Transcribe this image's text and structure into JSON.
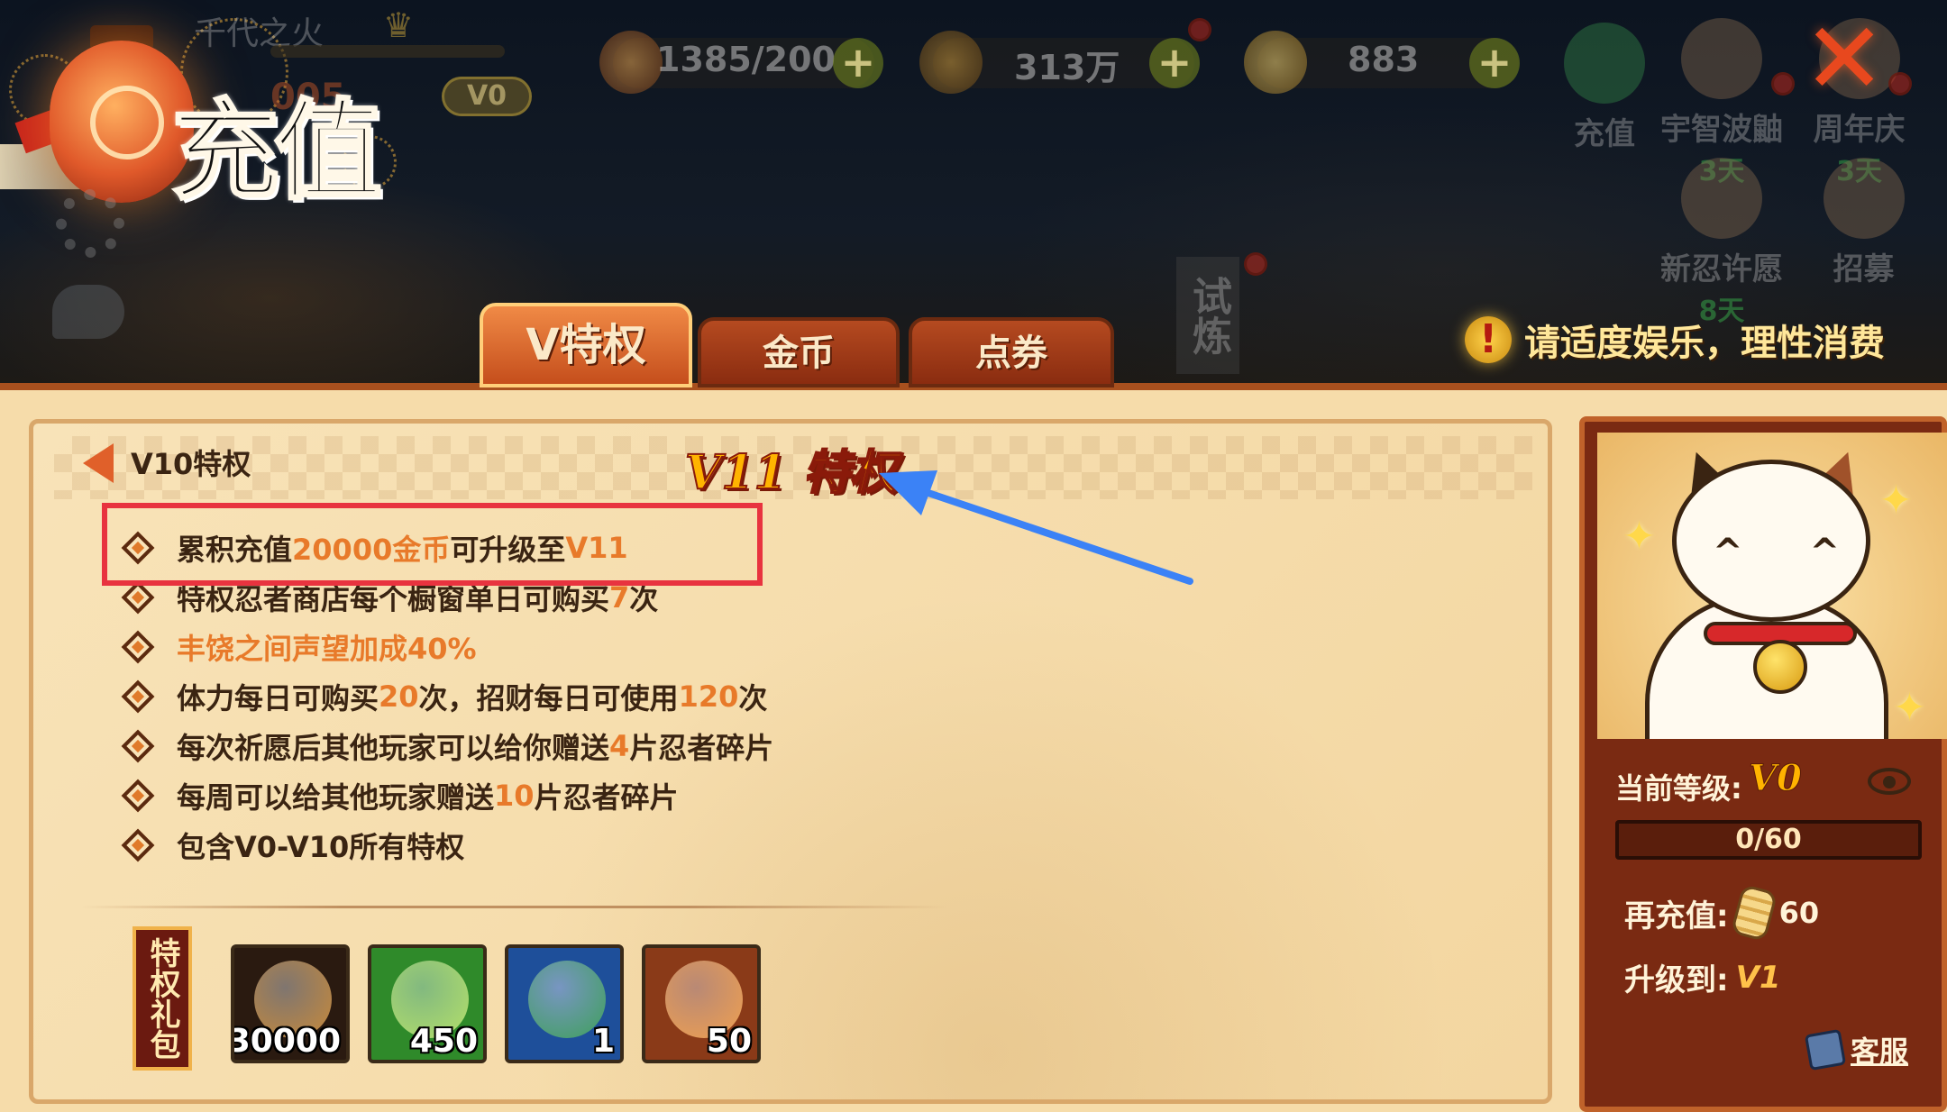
{
  "header": {
    "title": "充值",
    "player_name": "千代之火",
    "player_id": "005",
    "vip_badge": "V0"
  },
  "resources": [
    {
      "icon": "ramen-bowl-icon",
      "value": "1385/200"
    },
    {
      "icon": "copper-coin-icon",
      "value": "313万"
    },
    {
      "icon": "gold-coin-stack-icon",
      "value": "883"
    }
  ],
  "side_events": [
    {
      "label": "充值",
      "days": ""
    },
    {
      "label": "宇智波鼬",
      "days": "3天"
    },
    {
      "label": "周年庆",
      "days": "3天"
    },
    {
      "label": "新忍许愿",
      "days": "8天"
    },
    {
      "label": "招募",
      "days": ""
    }
  ],
  "trial_tag": "试炼",
  "notice": "请适度娱乐，理性消费",
  "tabs": [
    {
      "label": "V特权",
      "active": true
    },
    {
      "label": "金币",
      "active": false
    },
    {
      "label": "点券",
      "active": false
    }
  ],
  "privilege": {
    "prev_label": "V10特权",
    "title": "V11 特权",
    "items": [
      {
        "segments": [
          {
            "t": "累积充值",
            "hl": false
          },
          {
            "t": "20000金币",
            "hl": true
          },
          {
            "t": "可升级至",
            "hl": false
          },
          {
            "t": "V11",
            "hl": true
          }
        ]
      },
      {
        "segments": [
          {
            "t": "特权忍者商店每个橱窗单日可购买",
            "hl": false
          },
          {
            "t": "7",
            "hl": true
          },
          {
            "t": "次",
            "hl": false
          }
        ]
      },
      {
        "segments": [
          {
            "t": "丰饶之间声望加成40%",
            "hl": true
          }
        ]
      },
      {
        "segments": [
          {
            "t": "体力每日可购买",
            "hl": false
          },
          {
            "t": "20",
            "hl": true
          },
          {
            "t": "次，招财每日可使用",
            "hl": false
          },
          {
            "t": "120",
            "hl": true
          },
          {
            "t": "次",
            "hl": false
          }
        ]
      },
      {
        "segments": [
          {
            "t": "每次祈愿后其他玩家可以给你赠送",
            "hl": false
          },
          {
            "t": "4",
            "hl": true
          },
          {
            "t": "片忍者碎片",
            "hl": false
          }
        ]
      },
      {
        "segments": [
          {
            "t": "每周可以给其他玩家赠送",
            "hl": false
          },
          {
            "t": "10",
            "hl": true
          },
          {
            "t": "片忍者碎片",
            "hl": false
          }
        ]
      },
      {
        "segments": [
          {
            "t": "包含V0-V10所有特权",
            "hl": false
          }
        ]
      }
    ]
  },
  "gift": {
    "label": "特权礼包",
    "items": [
      {
        "icon": "copper-coin-icon",
        "count": "30000",
        "bg": "#2a1a10",
        "ic": "#c88a3a"
      },
      {
        "icon": "frog-icon",
        "count": "450",
        "bg": "#2f8a2a",
        "ic": "#b4e06a"
      },
      {
        "icon": "magatama-icon",
        "count": "1",
        "bg": "#1e4f9a",
        "ic": "#3ea05a"
      },
      {
        "icon": "ramen-bowl-icon",
        "count": "50",
        "bg": "#8a3a18",
        "ic": "#f0a050"
      }
    ]
  },
  "side_panel": {
    "current_level_label": "当前等级:",
    "current_level": "V0",
    "progress_text": "0/60",
    "progress": 0,
    "recharge_label": "再充值:",
    "recharge_amount": "60",
    "upgrade_label": "升级到:",
    "upgrade_to": "V1",
    "service_label": "客服"
  },
  "colors": {
    "accent_orange": "#e87a2a",
    "highlight_box": "#e8333f",
    "annotation_arrow": "#3b82f6"
  }
}
